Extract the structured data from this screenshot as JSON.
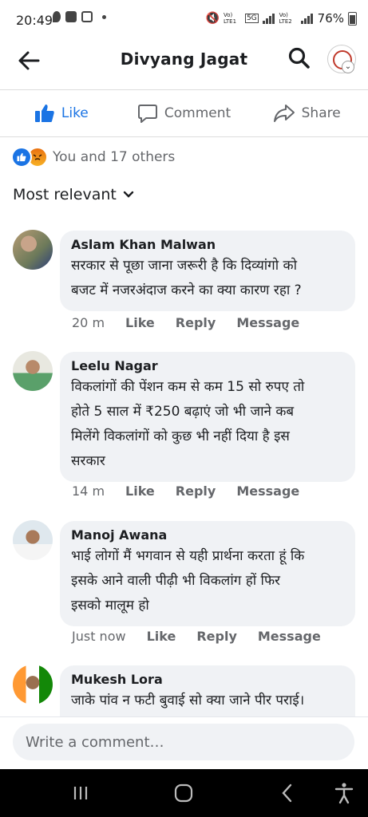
{
  "status_bar": {
    "time": "20:49",
    "carrier1": "Vo) LTE1",
    "carrier2": "Vo) LTE2",
    "network": "5G",
    "battery": "76%"
  },
  "header": {
    "title": "Divyang Jagat"
  },
  "actions": {
    "like": "Like",
    "comment": "Comment",
    "share": "Share"
  },
  "reactions": {
    "summary": "You and 17 others"
  },
  "sort": {
    "label": "Most relevant"
  },
  "comments": [
    {
      "name": "Aslam Khan Malwan",
      "lines": [
        "सरकार से पूछा जाना जरूरी है कि दिव्यांगो को",
        "बजट में नजरअंदाज करने का क्या कारण रहा ?"
      ],
      "time": "20 m",
      "like": "Like",
      "reply": "Reply",
      "message": "Message"
    },
    {
      "name": "Leelu Nagar",
      "lines": [
        "विकलांगों की पेंशन कम से कम 15 सो रुपए तो",
        "होते 5 साल में ₹250 बढ़ाएं जो भी जाने कब",
        "मिलेंगे विकलांगों को कुछ भी नहीं दिया है इस",
        "सरकार"
      ],
      "time": "14 m",
      "like": "Like",
      "reply": "Reply",
      "message": "Message"
    },
    {
      "name": "Manoj Awana",
      "lines": [
        "भाई लोगों मैं भगवान से यही प्रार्थना करता हूं कि",
        "इसके आने वाली पीढ़ी भी  विकलांग हों फिर",
        "इसको मालूम हो"
      ],
      "time": "Just now",
      "like": "Like",
      "reply": "Reply",
      "message": "Message"
    },
    {
      "name": "Mukesh Lora",
      "lines": [
        "जाके पांव न फटी बुवाई सो क्या जाने पीर पराई।"
      ]
    }
  ],
  "composer": {
    "placeholder": "Write a comment…"
  },
  "colors": {
    "accent": "#1b74e4",
    "bubble": "#f0f2f5",
    "muted": "#65676b"
  }
}
